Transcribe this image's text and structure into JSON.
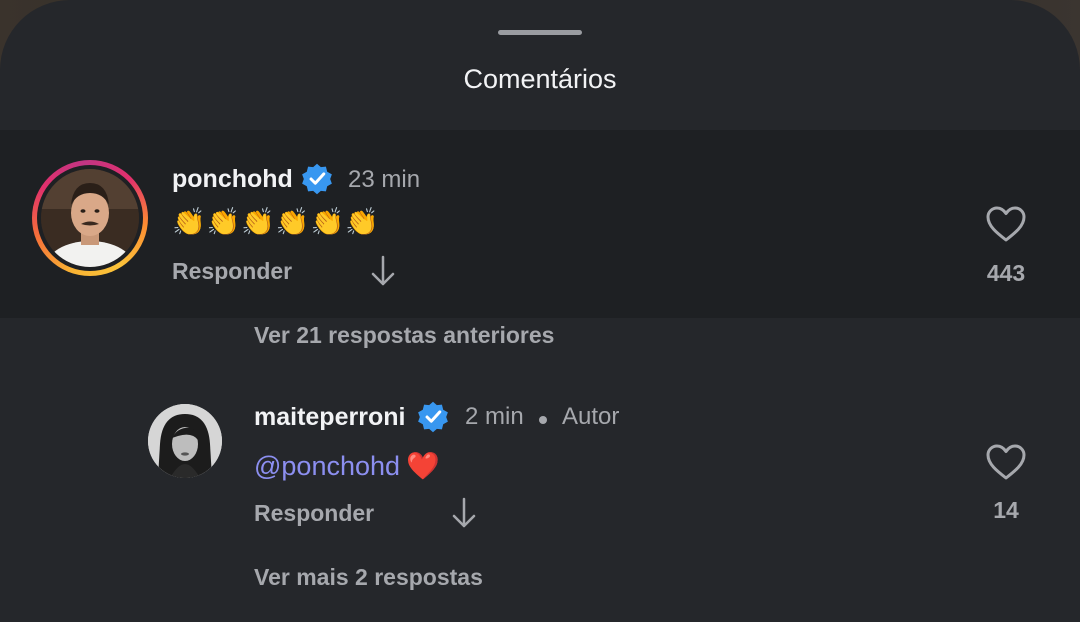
{
  "sheet": {
    "title": "Comentários"
  },
  "comments": [
    {
      "username": "ponchohd",
      "verified": true,
      "time": "23 min",
      "text": "👏👏👏👏👏👏",
      "reply_label": "Responder",
      "likes": "443",
      "avatar": "man-with-mustache-photo",
      "story_ring": true
    },
    {
      "username": "maiteperroni",
      "verified": true,
      "time": "2 min",
      "author_badge": "Autor",
      "mention": "@ponchohd",
      "emoji": "❤️",
      "reply_label": "Responder",
      "likes": "14",
      "avatar": "woman-black-and-white-photo"
    }
  ],
  "view_previous_replies": "Ver 21 respostas anteriores",
  "view_more_replies": "Ver mais 2 respostas",
  "colors": {
    "background": "#25272b",
    "highlight": "#1e2023",
    "text_primary": "#f2f3f5",
    "text_secondary": "#a6a8ad",
    "verified_blue": "#3897f0",
    "mention": "#8c8ff0"
  },
  "icons": {
    "verified": "verified-badge-icon",
    "like": "heart-outline-icon",
    "reply_arrow": "arrow-down-icon"
  }
}
